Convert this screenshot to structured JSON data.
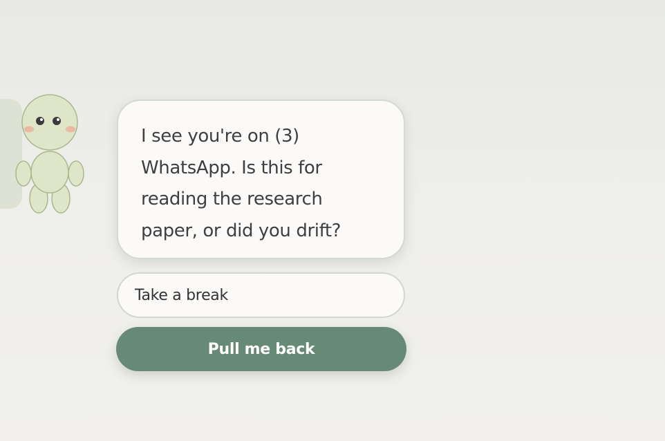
{
  "mascot": {
    "icon": "green-doll-mascot-icon"
  },
  "bubble": {
    "message": "I see you're on (3) WhatsApp. Is this for reading the research paper, or did you drift?"
  },
  "actions": {
    "break_label": "Take a break",
    "back_label": "Pull me back"
  },
  "colors": {
    "background": "#ebebe7",
    "bubble_background": "#fbfaf8",
    "primary_button": "#678a76",
    "mascot_body": "#dfe5c9",
    "mascot_outline": "#a8b88c",
    "cheek": "#eab9a2",
    "text": "#3f3f3f"
  }
}
